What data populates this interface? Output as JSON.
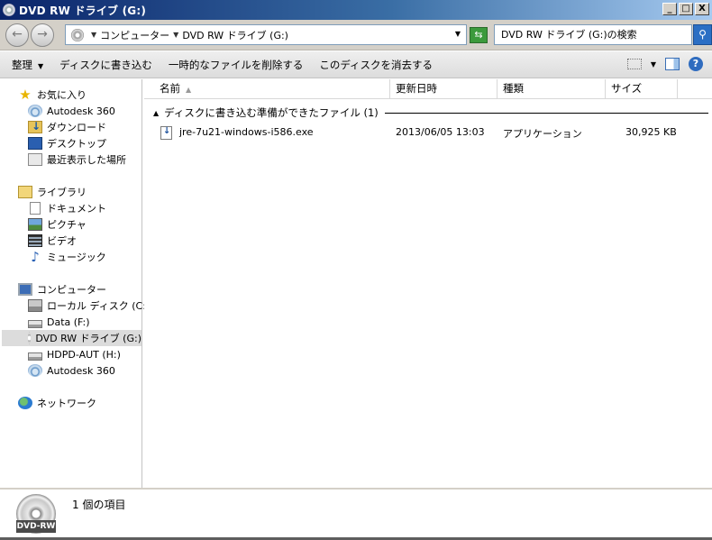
{
  "window": {
    "title": "DVD RW ドライブ (G:)",
    "minimize": "_",
    "maximize": "□",
    "close": "X"
  },
  "address": {
    "crumbs": [
      "コンピューター",
      "DVD RW ドライブ (G:)"
    ],
    "search_placeholder": "DVD RW ドライブ (G:)の検索"
  },
  "toolbar": {
    "organize": "整理",
    "burn": "ディスクに書き込む",
    "delete_temp": "一時的なファイルを削除する",
    "erase": "このディスクを消去する"
  },
  "nav": {
    "favorites": {
      "label": "お気に入り",
      "items": [
        "Autodesk 360",
        "ダウンロード",
        "デスクトップ",
        "最近表示した場所"
      ]
    },
    "libraries": {
      "label": "ライブラリ",
      "items": [
        "ドキュメント",
        "ピクチャ",
        "ビデオ",
        "ミュージック"
      ]
    },
    "computer": {
      "label": "コンピューター",
      "items": [
        "ローカル ディスク (C:)",
        "Data (F:)",
        "DVD RW ドライブ (G:)",
        "HDPD-AUT (H:)",
        "Autodesk 360"
      ],
      "selected": "DVD RW ドライブ (G:)"
    },
    "network": {
      "label": "ネットワーク"
    }
  },
  "columns": {
    "name": "名前",
    "modified": "更新日時",
    "type": "種類",
    "size": "サイズ"
  },
  "group": {
    "label": "ディスクに書き込む準備ができたファイル (1)"
  },
  "files": [
    {
      "name": "jre-7u21-windows-i586.exe",
      "modified": "2013/06/05 13:03",
      "type": "アプリケーション",
      "size": "30,925 KB"
    }
  ],
  "details": {
    "count": "1 個の項目",
    "drive_tag": "DVD-RW"
  }
}
